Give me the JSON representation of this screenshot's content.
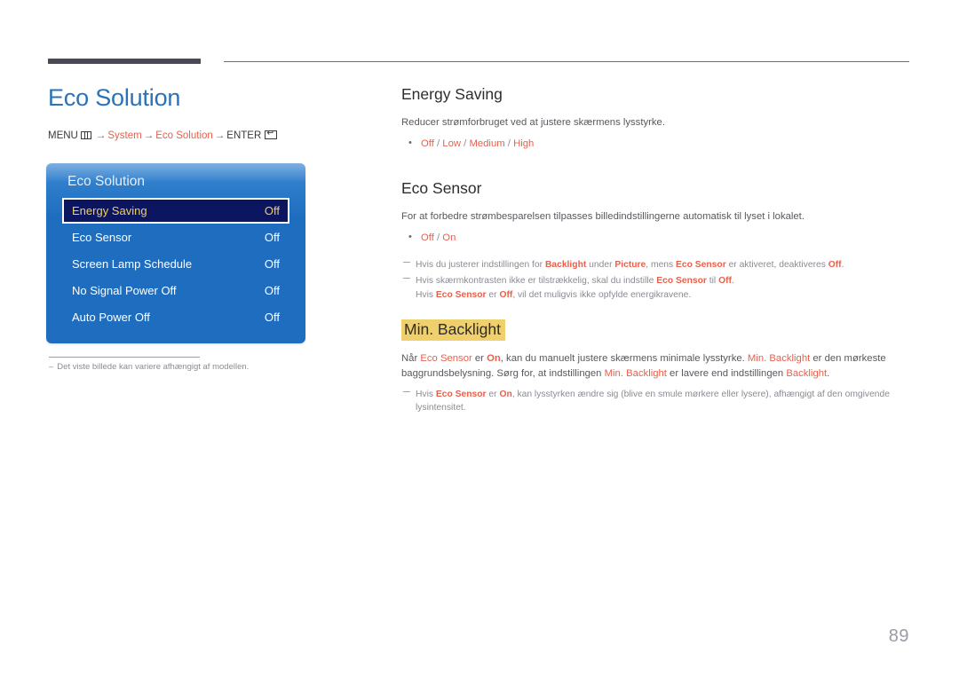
{
  "page": {
    "number": "89",
    "title": "Eco Solution",
    "title_color": "#2a73b8"
  },
  "breadcrumb": {
    "menu_label": "MENU",
    "menu_icon": "menu-grid-icon",
    "arrow": "→",
    "step1": "System",
    "step2": "Eco Solution",
    "enter_label": "ENTER",
    "enter_icon": "enter-return-icon",
    "accent_color": "#e8604c"
  },
  "osd_panel": {
    "title": "Eco Solution",
    "rows": [
      {
        "label": "Energy Saving",
        "value": "Off",
        "selected": true
      },
      {
        "label": "Eco Sensor",
        "value": "Off",
        "selected": false
      },
      {
        "label": "Screen Lamp Schedule",
        "value": "Off",
        "selected": false
      },
      {
        "label": "No Signal Power Off",
        "value": "Off",
        "selected": false
      },
      {
        "label": "Auto Power Off",
        "value": "Off",
        "selected": false
      }
    ],
    "bg_color": "#1f6dbf",
    "selected_bg": "#0b1560",
    "selected_text": "#f4cf5a"
  },
  "left_footnote": {
    "dash": "–",
    "text": "Det viste billede kan variere afhængigt af modellen."
  },
  "sections": {
    "energy_saving": {
      "heading": "Energy Saving",
      "paragraph": "Reducer strømforbruget ved at justere skærmens lysstyrke.",
      "options": [
        "Off",
        "Low",
        "Medium",
        "High"
      ],
      "separator": "/"
    },
    "eco_sensor": {
      "heading": "Eco Sensor",
      "paragraph": "For at forbedre strømbesparelsen tilpasses billedindstillingerne automatisk til lyset i lokalet.",
      "options": [
        "Off",
        "On"
      ],
      "separator": "/",
      "note1": {
        "t1": "Hvis du justerer indstillingen for ",
        "a1": "Backlight",
        "t2": " under ",
        "a2": "Picture",
        "t3": ", mens ",
        "a3": "Eco Sensor",
        "t4": " er aktiveret, deaktiveres ",
        "a4": "Off",
        "t5": "."
      },
      "note2": {
        "t1": "Hvis skærmkontrasten ikke er tilstrækkelig, skal du indstille ",
        "a1": "Eco Sensor",
        "t2": " til ",
        "a2": "Off",
        "t3": ".",
        "l2t1": "Hvis ",
        "l2a1": "Eco Sensor",
        "l2t2": " er ",
        "l2a2": "Off",
        "l2t3": ", vil det muligvis ikke opfylde energikravene."
      }
    },
    "min_backlight": {
      "heading": "Min. Backlight",
      "highlight_color": "#f0d06d",
      "paragraph": {
        "t1": "Når ",
        "a1": "Eco Sensor",
        "t2": " er ",
        "a2": "On",
        "t3": ", kan du manuelt justere skærmens minimale lysstyrke. ",
        "a3": "Min. Backlight",
        "t4": " er den mørkeste baggrundsbelysning. Sørg for, at indstillingen ",
        "a4": "Min. Backlight",
        "t5": " er lavere end indstillingen ",
        "a5": "Backlight",
        "t6": "."
      },
      "note": {
        "t1": "Hvis ",
        "a1": "Eco Sensor",
        "t2": " er ",
        "a2": "On",
        "t3": ", kan lysstyrken ændre sig (blive en smule mørkere eller lysere), afhængigt af den omgivende lysintensitet."
      }
    }
  }
}
